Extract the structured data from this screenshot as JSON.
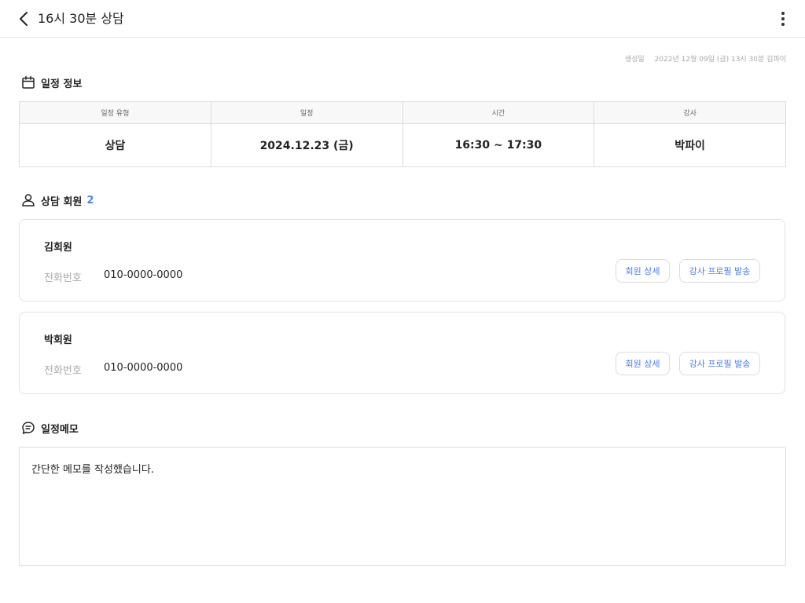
{
  "header": {
    "title": "16시 30분 상담",
    "back_icon": "chevron-left-icon",
    "more_icon": "more-vertical-icon"
  },
  "created": {
    "label": "생성일",
    "value": "2022년 12월 09일 (금) 13시 30분 김파이"
  },
  "schedule_info": {
    "title": "일정 정보",
    "icon": "calendar-icon",
    "columns": [
      {
        "header": "일정 유형",
        "value": "상담"
      },
      {
        "header": "일정",
        "value": "2024.12.23 (금)"
      },
      {
        "header": "시간",
        "value": "16:30 ~ 17:30"
      },
      {
        "header": "강사",
        "value": "박파이"
      }
    ]
  },
  "members": {
    "title": "상담 회원",
    "count": "2",
    "icon": "user-icon",
    "items": [
      {
        "name": "김회원",
        "phone_label": "전화번호",
        "phone": "010-0000-0000",
        "detail_button": "회원 상세",
        "send_button": "강사 프로필 발송"
      },
      {
        "name": "박회원",
        "phone_label": "전화번호",
        "phone": "010-0000-0000",
        "detail_button": "회원 상세",
        "send_button": "강사 프로필 발송"
      }
    ]
  },
  "memo": {
    "title": "일정메모",
    "icon": "chat-bubble-icon",
    "content": "간단한 메모를 작성했습니다."
  },
  "colors": {
    "accent": "#4c86f0",
    "border": "#dcdcdc",
    "muted": "#aaaaaa"
  }
}
